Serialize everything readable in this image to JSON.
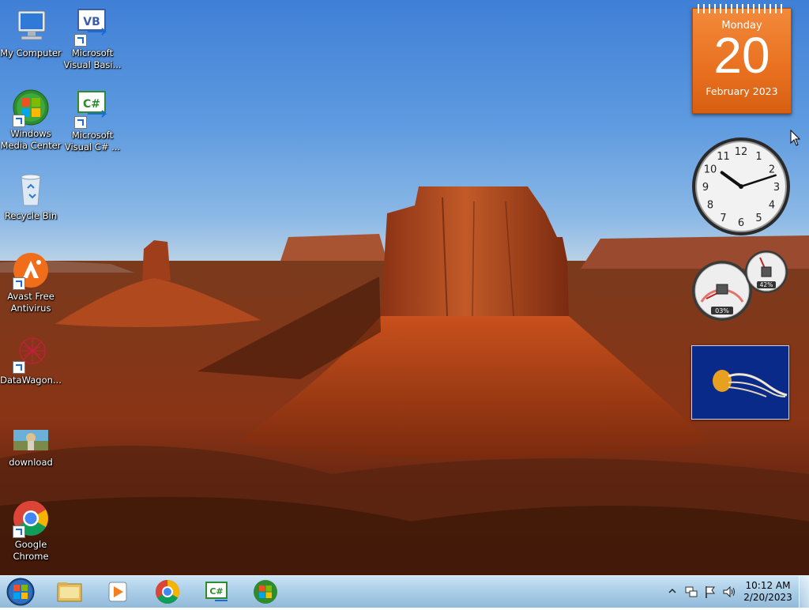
{
  "desktop": {
    "icons": [
      {
        "label": "My Computer"
      },
      {
        "label": "Microsoft\nVisual Basi..."
      },
      {
        "label": "Windows\nMedia Center"
      },
      {
        "label": "Microsoft\nVisual C# ..."
      },
      {
        "label": "Recycle Bin"
      },
      {
        "label": "Avast Free\nAntivirus"
      },
      {
        "label": "DataWagon..."
      },
      {
        "label": "download"
      },
      {
        "label": "Google\nChrome"
      }
    ]
  },
  "gadgets": {
    "calendar": {
      "weekday": "Monday",
      "day": "20",
      "month_year": "February 2023"
    },
    "clock": {
      "hour": 10,
      "minute": 12
    },
    "cpu_meter": {
      "cpu_text": "03%",
      "memory_text": "42%"
    }
  },
  "taskbar": {
    "time": "10:12 AM",
    "date": "2/20/2023",
    "pinned": [
      "windows-explorer",
      "media-player",
      "google-chrome",
      "visual-csharp",
      "windows-media-center"
    ]
  },
  "colors": {
    "calendar_orange": "#e8701f",
    "taskbar_blue": "#a8cde8"
  }
}
